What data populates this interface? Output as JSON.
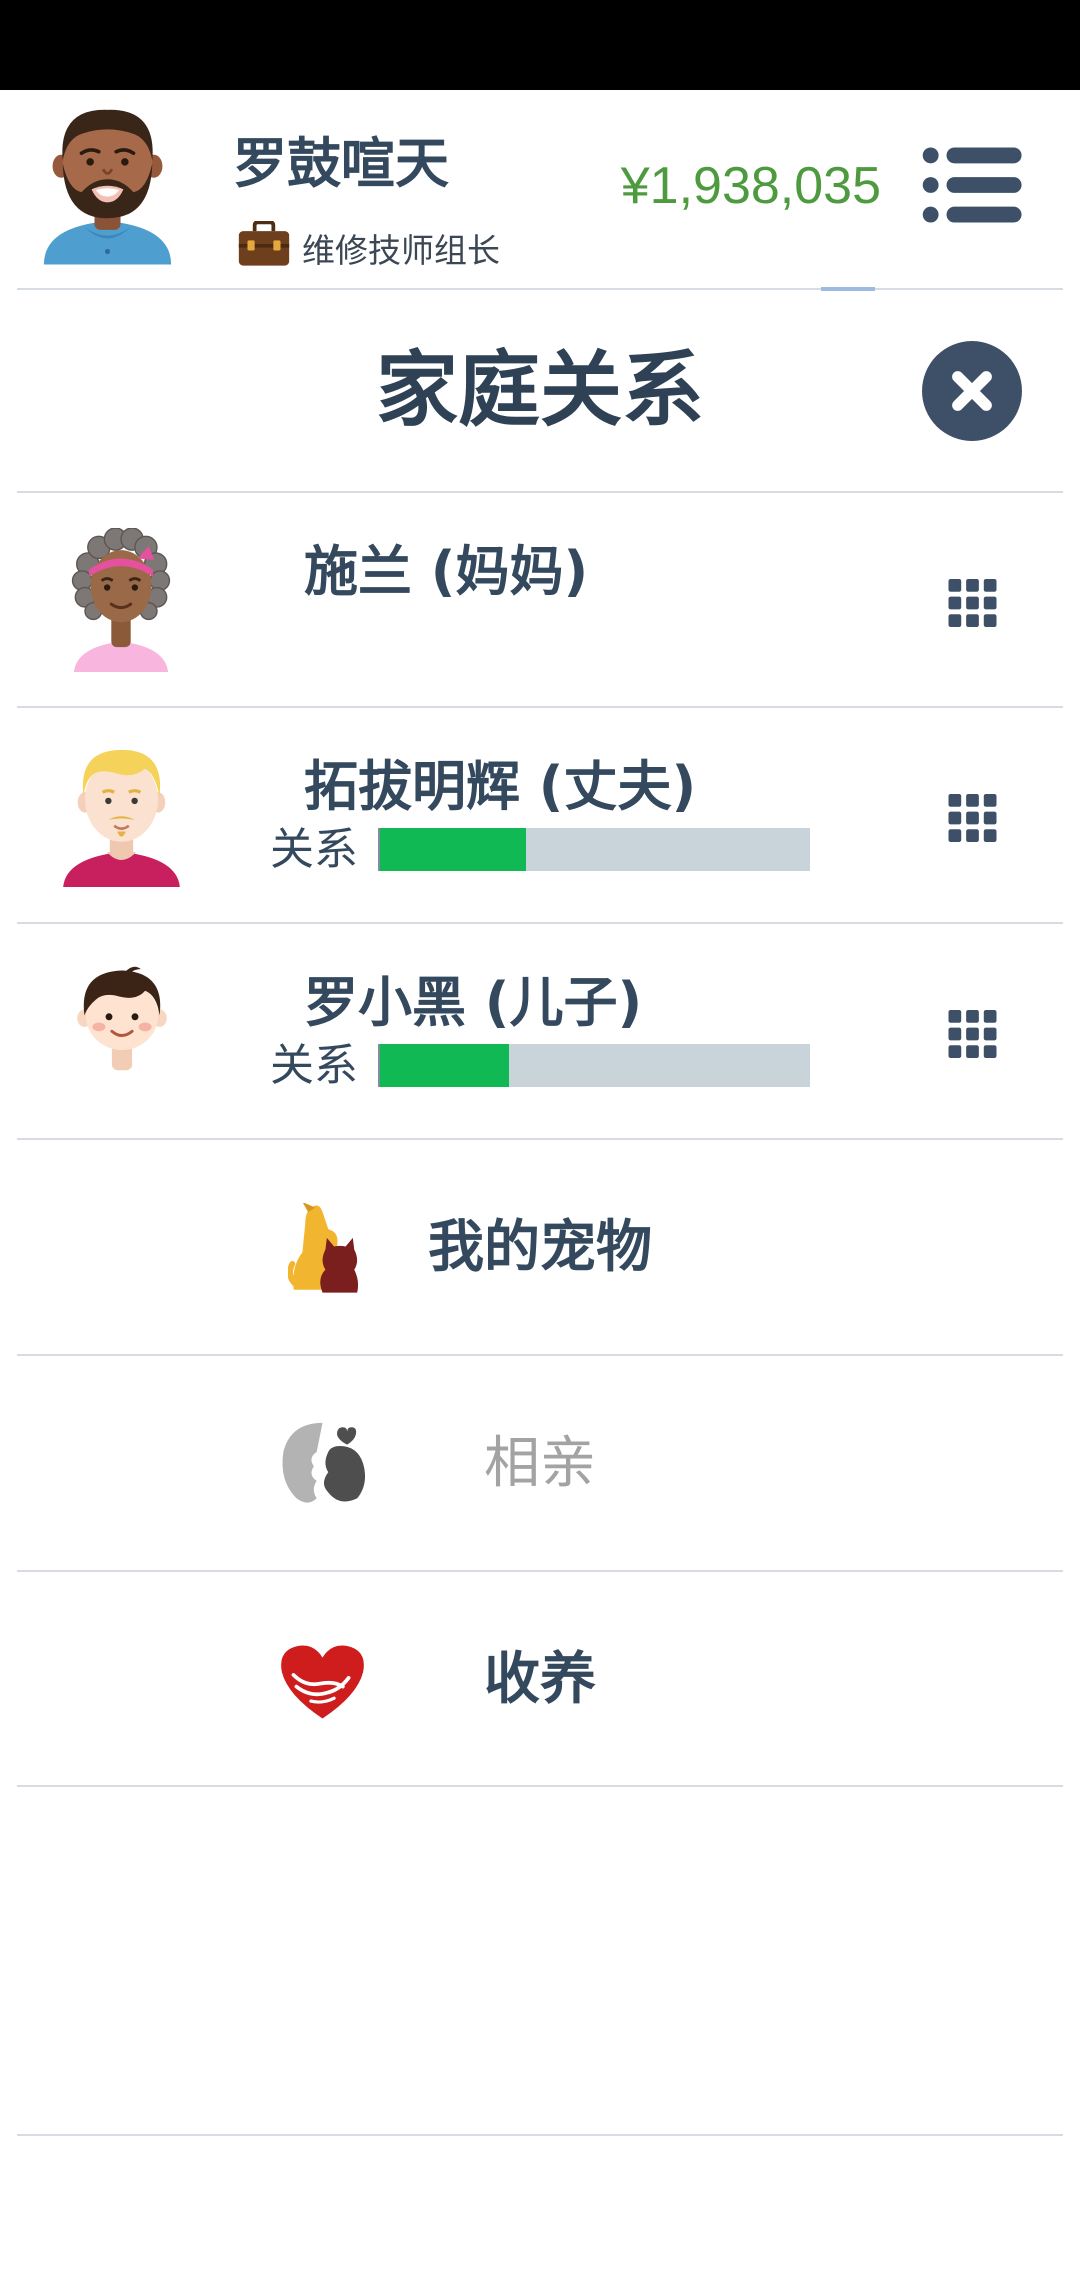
{
  "header": {
    "avatar_icon": "player-avatar",
    "player_name": "罗鼓喧天",
    "job_icon": "briefcase-icon",
    "job_title": "维修技师组长",
    "money": "¥1,938,035",
    "menu_icon": "menu-list-icon"
  },
  "panel": {
    "title": "家庭关系",
    "close_icon": "close-icon"
  },
  "family": [
    {
      "name": "施兰 (妈妈)",
      "avatar_icon": "mother-avatar",
      "options_icon": "grid-icon"
    },
    {
      "name": "拓拔明辉 (丈夫)",
      "avatar_icon": "husband-avatar",
      "relationship_label": "关系",
      "relationship": 0.34,
      "options_icon": "grid-icon"
    },
    {
      "name": "罗小黑 (儿子)",
      "avatar_icon": "son-avatar",
      "relationship_label": "关系",
      "relationship": 0.3,
      "options_icon": "grid-icon"
    }
  ],
  "actions": [
    {
      "label": "我的宠物",
      "icon": "pet-icon",
      "disabled": false
    },
    {
      "label": "相亲",
      "icon": "matchmaking-icon",
      "disabled": true
    },
    {
      "label": "收养",
      "icon": "adoption-heart-icon",
      "disabled": false
    }
  ],
  "colors": {
    "text": "#34495e",
    "title": "#2f4155",
    "money": "#4e9a3f",
    "bar_fill": "#10b954",
    "bar_track": "#c9d3da",
    "disabled_text": "#a3a3a3",
    "icon_dark": "#3d5068"
  }
}
